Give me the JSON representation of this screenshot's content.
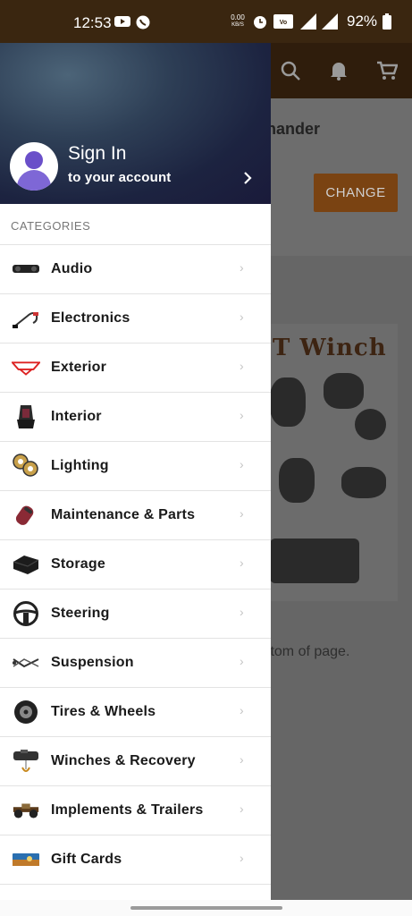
{
  "status_bar": {
    "time": "12:53",
    "net_speed_value": "0.00",
    "net_speed_unit": "KB/S",
    "battery": "92%",
    "volte_label": "VoLTE",
    "signal_label": "4G"
  },
  "background": {
    "header_icons": [
      "search-icon",
      "bell-icon",
      "cart-icon"
    ],
    "partial_title": "nander",
    "change_button": "CHANGE",
    "image_text": "T Winch",
    "bottom_text": "ttom of page."
  },
  "drawer": {
    "sign_in_title": "Sign In",
    "sign_in_subtitle": "to your account",
    "categories_label": "CATEGORIES",
    "categories": [
      {
        "label": "Audio",
        "icon": "speaker-bar-icon"
      },
      {
        "label": "Electronics",
        "icon": "cable-icon"
      },
      {
        "label": "Exterior",
        "icon": "red-bumper-icon"
      },
      {
        "label": "Interior",
        "icon": "seat-icon"
      },
      {
        "label": "Lighting",
        "icon": "led-lights-icon"
      },
      {
        "label": "Maintenance & Parts",
        "icon": "filter-icon"
      },
      {
        "label": "Storage",
        "icon": "storage-box-icon"
      },
      {
        "label": "Steering",
        "icon": "steering-wheel-icon"
      },
      {
        "label": "Suspension",
        "icon": "suspension-arm-icon"
      },
      {
        "label": "Tires & Wheels",
        "icon": "tire-icon"
      },
      {
        "label": "Winches & Recovery",
        "icon": "winch-icon"
      },
      {
        "label": "Implements & Trailers",
        "icon": "implement-icon"
      },
      {
        "label": "Gift Cards",
        "icon": "gift-card-icon"
      }
    ]
  },
  "colors": {
    "status_bar": "#3a2610",
    "app_header": "#2f1d0c",
    "change_button": "#7a4312",
    "avatar": "#6a4fc9"
  }
}
